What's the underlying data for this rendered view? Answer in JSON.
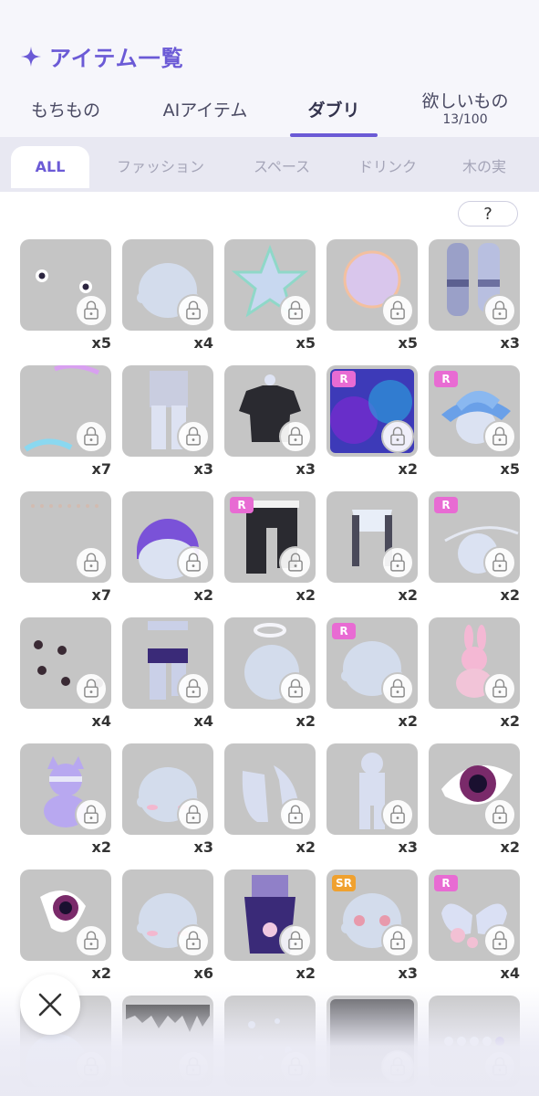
{
  "header": {
    "title": "アイテム一覧",
    "sparkle_icon": "sparkle-icon",
    "accent": "#6b5ad6"
  },
  "tabs": [
    {
      "label": "もちもの"
    },
    {
      "label": "AIアイテム"
    },
    {
      "label": "ダブリ",
      "active": true
    },
    {
      "label": "欲しいもの",
      "sub": "13/100"
    }
  ],
  "filters": [
    "ALL",
    "ファッション",
    "スペース",
    "ドリンク",
    "木の実"
  ],
  "help": {
    "label": "?"
  },
  "items": [
    {
      "kind": "flowers",
      "count": "x5"
    },
    {
      "kind": "head",
      "count": "x4"
    },
    {
      "kind": "star",
      "count": "x5"
    },
    {
      "kind": "bubble",
      "count": "x5"
    },
    {
      "kind": "socks",
      "count": "x3"
    },
    {
      "kind": "arcs",
      "count": "x7"
    },
    {
      "kind": "pants",
      "count": "x3"
    },
    {
      "kind": "tshirt",
      "count": "x3"
    },
    {
      "kind": "galaxy",
      "badge": "R",
      "count": "x2"
    },
    {
      "kind": "hat",
      "badge": "R",
      "count": "x5"
    },
    {
      "kind": "dots",
      "count": "x7"
    },
    {
      "kind": "purplehair",
      "count": "x2"
    },
    {
      "kind": "blackpants",
      "badge": "R",
      "count": "x2"
    },
    {
      "kind": "suspenders",
      "count": "x2"
    },
    {
      "kind": "ring",
      "badge": "R",
      "count": "x2"
    },
    {
      "kind": "hearts",
      "count": "x4"
    },
    {
      "kind": "skirt",
      "count": "x4"
    },
    {
      "kind": "halo",
      "count": "x2"
    },
    {
      "kind": "head",
      "badge": "R",
      "count": "x2"
    },
    {
      "kind": "bunny",
      "count": "x2"
    },
    {
      "kind": "cat",
      "count": "x2"
    },
    {
      "kind": "blush",
      "count": "x3"
    },
    {
      "kind": "sleeves",
      "count": "x2"
    },
    {
      "kind": "body",
      "count": "x3"
    },
    {
      "kind": "eye",
      "count": "x2"
    },
    {
      "kind": "eyesmall",
      "count": "x2"
    },
    {
      "kind": "blush",
      "count": "x6"
    },
    {
      "kind": "kimono",
      "count": "x2"
    },
    {
      "kind": "eyesface",
      "badge": "SR",
      "count": "x3"
    },
    {
      "kind": "flowerwings",
      "badge": "R",
      "count": "x4"
    },
    {
      "kind": "partial",
      "count": ""
    },
    {
      "kind": "drips",
      "count": ""
    },
    {
      "kind": "bubbles",
      "count": ""
    },
    {
      "kind": "dark",
      "count": ""
    },
    {
      "kind": "minihearts",
      "count": ""
    }
  ],
  "close": {
    "icon": "close-icon"
  }
}
